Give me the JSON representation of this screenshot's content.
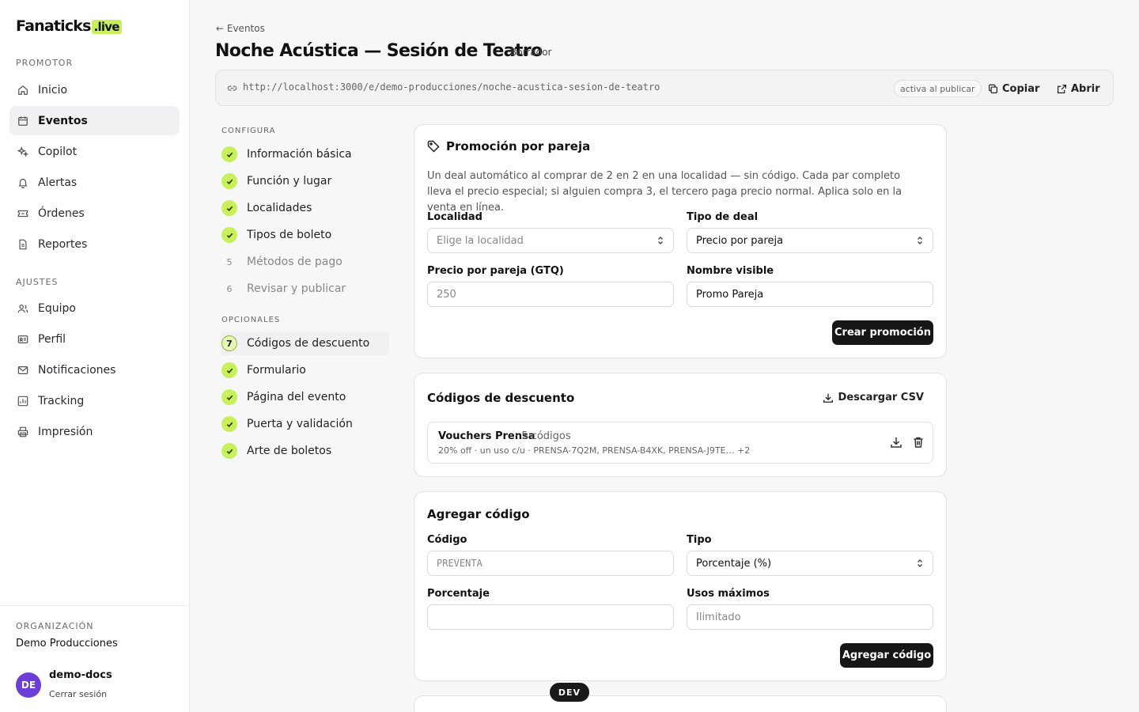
{
  "brand": {
    "name": "Fanaticks",
    "suffix": ".live",
    "accent": "#c8f05a"
  },
  "sidebar": {
    "section_promotor": "PROMOTOR",
    "promotor_items": [
      {
        "label": "Inicio",
        "icon": "home-icon"
      },
      {
        "label": "Eventos",
        "icon": "calendar-icon",
        "active": true
      },
      {
        "label": "Copilot",
        "icon": "sparkle-icon"
      },
      {
        "label": "Alertas",
        "icon": "bell-icon"
      },
      {
        "label": "Órdenes",
        "icon": "ticket-icon"
      },
      {
        "label": "Reportes",
        "icon": "document-icon"
      }
    ],
    "section_ajustes": "AJUSTES",
    "ajustes_items": [
      {
        "label": "Equipo",
        "icon": "users-icon"
      },
      {
        "label": "Perfil",
        "icon": "id-card-icon"
      },
      {
        "label": "Notificaciones",
        "icon": "mail-icon"
      },
      {
        "label": "Tracking",
        "icon": "chart-icon"
      },
      {
        "label": "Impresión",
        "icon": "printer-icon"
      }
    ],
    "org_label": "ORGANIZACIÓN",
    "org_name": "Demo Producciones",
    "user": {
      "initials": "DE",
      "name": "demo-docs",
      "logout": "Cerrar sesión"
    }
  },
  "header": {
    "back": "Eventos",
    "title": "Noche Acústica — Sesión de Teatro",
    "status": "Borrador",
    "url": "http://localhost:3000/e/demo-producciones/noche-acustica-sesion-de-teatro",
    "url_status": "activa al publicar",
    "copy": "Copiar",
    "open": "Abrir"
  },
  "steps": {
    "configura_label": "CONFIGURA",
    "configura": [
      {
        "label": "Información básica",
        "done": true
      },
      {
        "label": "Función y lugar",
        "done": true
      },
      {
        "label": "Localidades",
        "done": true
      },
      {
        "label": "Tipos de boleto",
        "done": true
      },
      {
        "label": "Métodos de pago",
        "done": false,
        "num": "5"
      },
      {
        "label": "Revisar y publicar",
        "done": false,
        "num": "6"
      }
    ],
    "opcionales_label": "OPCIONALES",
    "opcionales": [
      {
        "label": "Códigos de descuento",
        "done": false,
        "num": "7",
        "current": true
      },
      {
        "label": "Formulario",
        "done": true
      },
      {
        "label": "Página del evento",
        "done": true
      },
      {
        "label": "Puerta y validación",
        "done": true
      },
      {
        "label": "Arte de boletos",
        "done": true
      }
    ]
  },
  "promo": {
    "title": "Promoción por pareja",
    "description": "Un deal automático al comprar de 2 en 2 en una localidad — sin código. Cada par completo lleva el precio especial; si alguien compra 3, el tercero paga precio normal. Aplica solo en la venta en línea.",
    "localidad_label": "Localidad",
    "localidad_placeholder": "Elige la localidad",
    "tipo_label": "Tipo de deal",
    "tipo_value": "Precio por pareja",
    "precio_label": "Precio por pareja (GTQ)",
    "precio_placeholder": "250",
    "nombre_label": "Nombre visible",
    "nombre_value": "Promo Pareja",
    "submit": "Crear promoción"
  },
  "codes": {
    "title": "Códigos de descuento",
    "download": "Descargar CSV",
    "voucher_name": "Vouchers Prensa",
    "voucher_count": "· 5 códigos",
    "voucher_detail": "20% off · un uso c/u · PRENSA-7Q2M, PRENSA-B4XK, PRENSA-J9TE… +2"
  },
  "add_code": {
    "title": "Agregar código",
    "codigo_label": "Código",
    "codigo_placeholder": "PREVENTA",
    "tipo_label": "Tipo",
    "tipo_value": "Porcentaje (%)",
    "porcentaje_label": "Porcentaje",
    "porcentaje_value": "",
    "usos_label": "Usos máximos",
    "usos_placeholder": "Ilimitado",
    "submit": "Agregar código"
  },
  "dev_badge": "DEV"
}
